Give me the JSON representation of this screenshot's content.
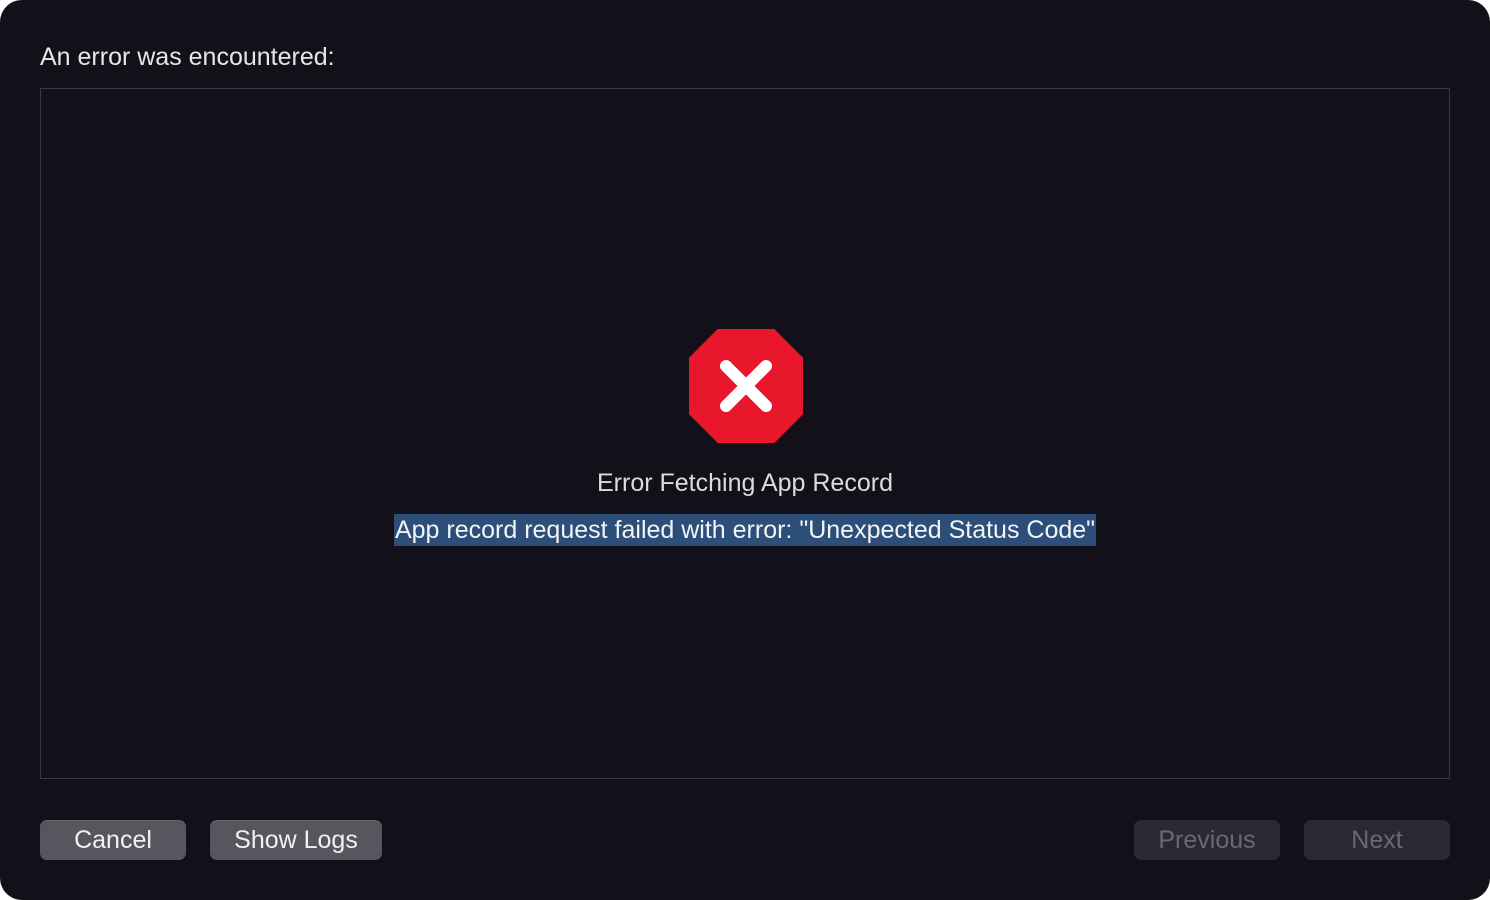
{
  "dialog": {
    "heading": "An error was encountered:"
  },
  "error": {
    "icon": "error-stop-icon",
    "title": "Error Fetching App Record",
    "message": "App record request failed with error: \"Unexpected Status Code\""
  },
  "buttons": {
    "cancel": "Cancel",
    "show_logs": "Show Logs",
    "previous": "Previous",
    "next": "Next"
  },
  "colors": {
    "background": "#13101a",
    "error_red": "#e8172c",
    "selection": "#2d4e78"
  }
}
